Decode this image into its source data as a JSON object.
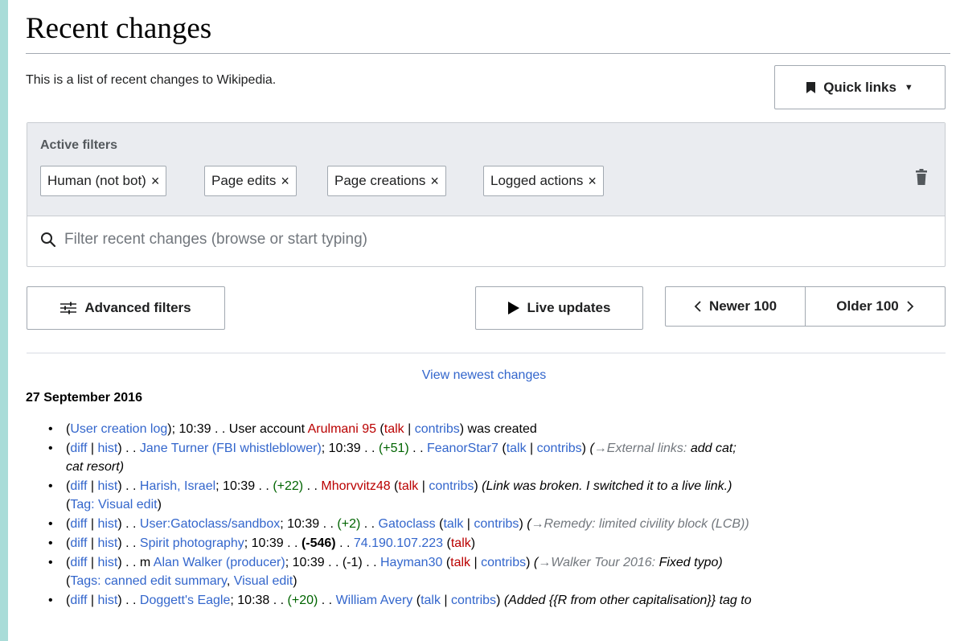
{
  "page": {
    "title": "Recent changes",
    "intro": "This is a list of recent changes to Wikipedia."
  },
  "quick_links": {
    "label": "Quick links"
  },
  "filters": {
    "label": "Active filters",
    "chips": [
      {
        "label": "Human (not bot)"
      },
      {
        "label": "Page edits"
      },
      {
        "label": "Page creations"
      },
      {
        "label": "Logged actions"
      }
    ],
    "remove_symbol": "×",
    "search_placeholder": "Filter recent changes (browse or start typing)"
  },
  "toolbar": {
    "advanced_filters": "Advanced filters",
    "live_updates": "Live updates",
    "newer": "Newer 100",
    "older": "Older 100"
  },
  "view_newest": "View newest changes",
  "date": "27 September 2016",
  "changes": [
    {
      "log": "User creation log",
      "time": "10:39",
      "text_before": "User account",
      "user": "Arulmani 95",
      "talk": "talk",
      "contribs": "contribs",
      "text_after": "was created"
    },
    {
      "diff": "diff",
      "hist": "hist",
      "page": "Jane Turner (FBI whistleblower)",
      "time": "10:39",
      "size": "(+51)",
      "user": "FeanorStar7",
      "talk": "talk",
      "contribs": "contribs",
      "section": "External links:",
      "comment": "add cat;",
      "comment2": "cat resort)"
    },
    {
      "diff": "diff",
      "hist": "hist",
      "page": "Harish, Israel",
      "time": "10:39",
      "size": "(+22)",
      "user": "Mhorvvitz48",
      "talk": "talk",
      "contribs": "contribs",
      "comment": "(Link was broken. I switched it to a live link.)",
      "tag_label": "Tag:",
      "tags": [
        "Visual edit"
      ]
    },
    {
      "diff": "diff",
      "hist": "hist",
      "page": "User:Gatoclass/sandbox",
      "time": "10:39",
      "size": "(+2)",
      "user": "Gatoclass",
      "talk": "talk",
      "contribs": "contribs",
      "section": "Remedy: limited civility block (LCB))"
    },
    {
      "diff": "diff",
      "hist": "hist",
      "page": "Spirit photography",
      "time": "10:39",
      "size": "(-546)",
      "user": "74.190.107.223",
      "talk": "talk"
    },
    {
      "diff": "diff",
      "hist": "hist",
      "minor": "m",
      "page": "Alan Walker (producer)",
      "time": "10:39",
      "size": "(-1)",
      "user": "Hayman30",
      "talk": "talk",
      "contribs": "contribs",
      "section": "Walker Tour 2016:",
      "comment": "Fixed typo)",
      "tag_label": "Tags:",
      "tags": [
        "canned edit summary",
        "Visual edit"
      ]
    },
    {
      "diff": "diff",
      "hist": "hist",
      "page": "Doggett's Eagle",
      "time": "10:38",
      "size": "(+20)",
      "user": "William Avery",
      "talk": "talk",
      "contribs": "contribs",
      "comment": "(Added {{R from other capitalisation}} tag to"
    }
  ]
}
